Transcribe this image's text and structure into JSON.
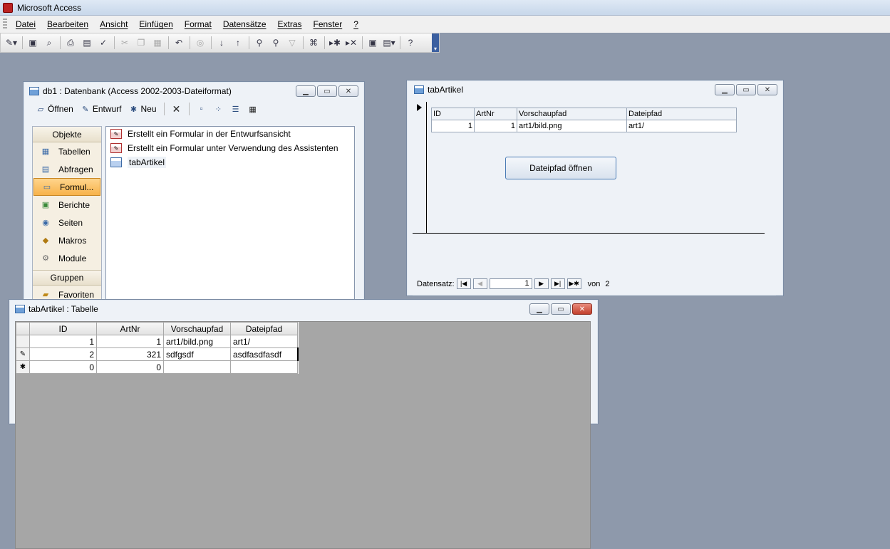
{
  "app": {
    "title": "Microsoft Access"
  },
  "menu": [
    "Datei",
    "Bearbeiten",
    "Ansicht",
    "Einfügen",
    "Format",
    "Datensätze",
    "Extras",
    "Fenster",
    "?"
  ],
  "db_window": {
    "title": "db1 : Datenbank (Access 2002-2003-Dateiformat)",
    "toolbar": {
      "open": "Öffnen",
      "design": "Entwurf",
      "new": "Neu"
    },
    "objects_header": "Objekte",
    "groups_header": "Gruppen",
    "nav_items": [
      "Tabellen",
      "Abfragen",
      "Formul...",
      "Berichte",
      "Seiten",
      "Makros",
      "Module"
    ],
    "favorites": "Favoriten",
    "list_items": [
      "Erstellt ein Formular in der Entwurfsansicht",
      "Erstellt ein Formular unter Verwendung des Assistenten",
      "tabArtikel"
    ]
  },
  "form_window": {
    "title": "tabArtikel",
    "columns": [
      "ID",
      "ArtNr",
      "Vorschaupfad",
      "Dateipfad"
    ],
    "row": [
      "1",
      "1",
      "art1/bild.png",
      "art1/"
    ],
    "button": "Dateipfad öffnen",
    "nav": {
      "label": "Datensatz:",
      "current": "1",
      "of_label": "von",
      "total": "2"
    }
  },
  "table_window": {
    "title": "tabArtikel : Tabelle",
    "columns": [
      "ID",
      "ArtNr",
      "Vorschaupfad",
      "Dateipfad"
    ],
    "rows": [
      {
        "selector": "",
        "cells": [
          "1",
          "1",
          "art1/bild.png",
          "art1/"
        ]
      },
      {
        "selector": "✎",
        "cells": [
          "2",
          "321",
          "sdfgsdf",
          "asdfasdfasdf"
        ]
      },
      {
        "selector": "✱",
        "cells": [
          "0",
          "0",
          "",
          ""
        ]
      }
    ]
  }
}
